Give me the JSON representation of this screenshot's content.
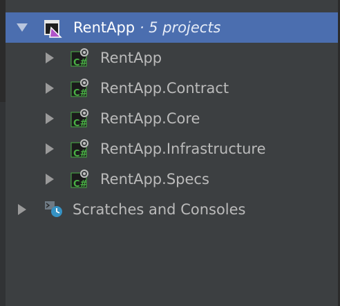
{
  "tree": {
    "solution": {
      "name": "RentApp",
      "sub": " · 5 projects",
      "icon": "solution-icon"
    },
    "projects": [
      {
        "label": "RentApp",
        "icon": "csharp-project-icon"
      },
      {
        "label": "RentApp.Contract",
        "icon": "csharp-project-icon"
      },
      {
        "label": "RentApp.Core",
        "icon": "csharp-project-icon"
      },
      {
        "label": "RentApp.Infrastructure",
        "icon": "csharp-project-icon"
      },
      {
        "label": "RentApp.Specs",
        "icon": "csharp-project-icon"
      }
    ],
    "scratches": {
      "label": "Scratches and Consoles",
      "icon": "scratches-icon"
    }
  },
  "colors": {
    "background": "#3c3f41",
    "selection": "#4b6eaf",
    "text": "#bbbbbb",
    "csharp_green": "#49b045"
  }
}
